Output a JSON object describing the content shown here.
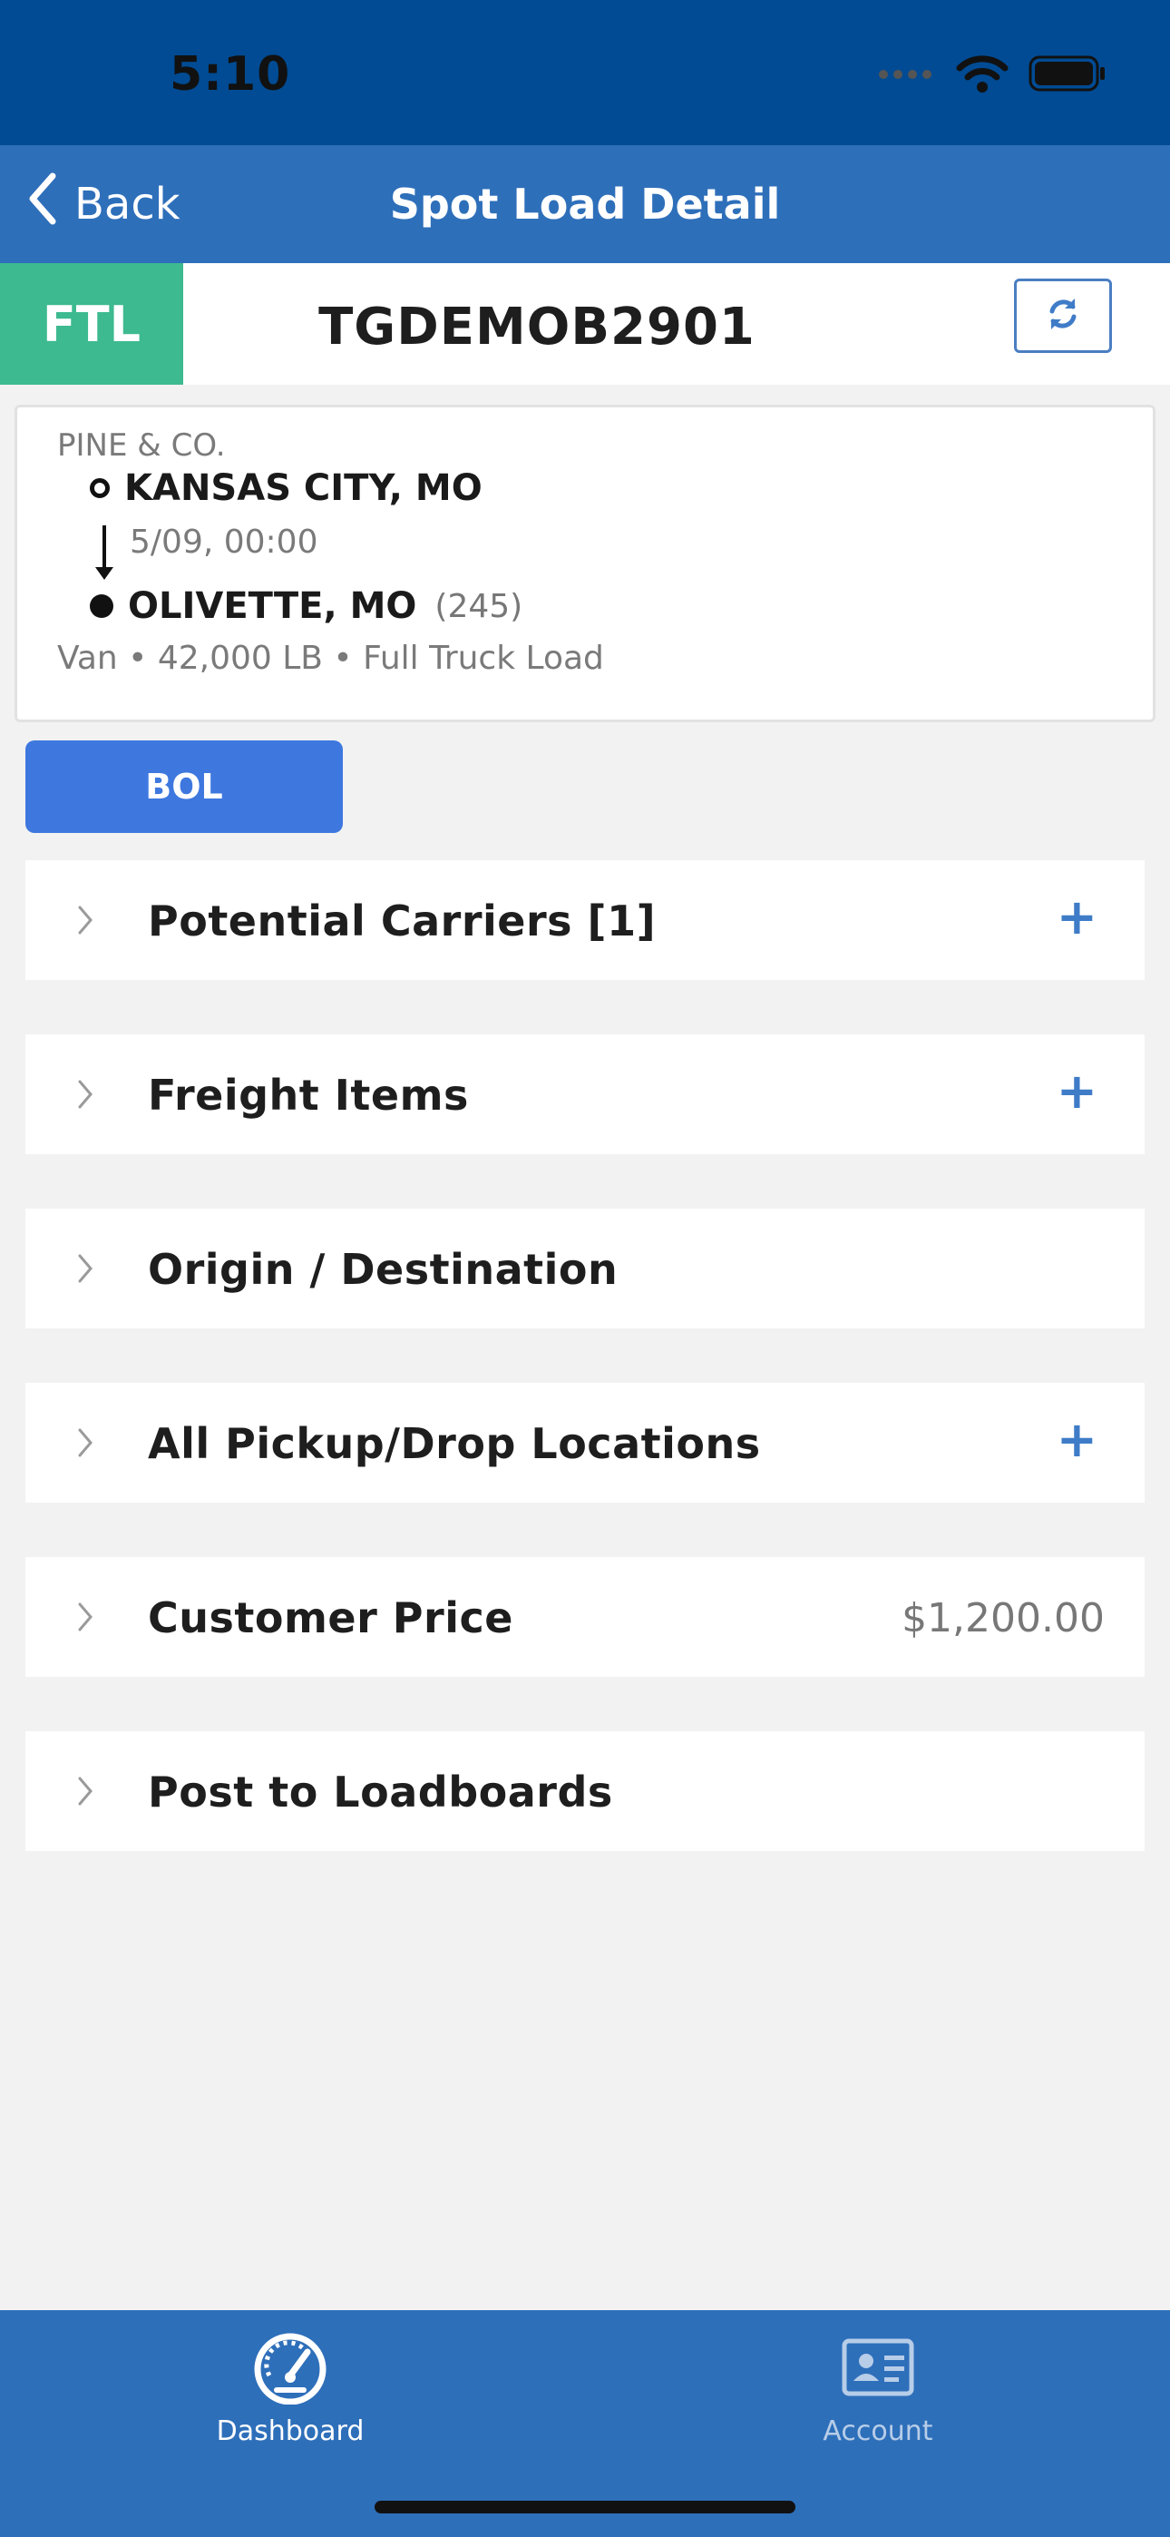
{
  "status_bar": {
    "time": "5:10"
  },
  "nav": {
    "back_label": "Back",
    "title": "Spot Load Detail"
  },
  "load": {
    "mode_badge": "FTL",
    "id": "TGDEMOB2901",
    "mode_color": "#3dba8f"
  },
  "summary": {
    "shipper": "PINE & CO.",
    "origin_city": "KANSAS CITY, MO",
    "pickup_datetime": "5/09, 00:00",
    "destination_city": "OLIVETTE, MO",
    "miles": "(245)",
    "specs": "Van • 42,000 LB • Full Truck Load"
  },
  "actions": {
    "bol_label": "BOL"
  },
  "sections": [
    {
      "title": "Potential Carriers [1]",
      "has_add": true
    },
    {
      "title": "Freight Items",
      "has_add": true
    },
    {
      "title": "Origin / Destination",
      "has_add": false
    },
    {
      "title": "All Pickup/Drop Locations",
      "has_add": true
    },
    {
      "title": "Customer Price",
      "value": "$1,200.00"
    },
    {
      "title": "Post to Loadboards",
      "has_add": false
    }
  ],
  "add_symbol": "+",
  "tab_bar": {
    "tabs": [
      {
        "label": "Dashboard",
        "icon": "speedometer-icon",
        "active": true
      },
      {
        "label": "Account",
        "icon": "id-card-icon",
        "active": false
      }
    ]
  },
  "colors": {
    "status_bar": "#004b93",
    "nav_bar": "#2e6fba",
    "accent_button": "#3e78df",
    "plus_icon": "#3f7cc8"
  }
}
